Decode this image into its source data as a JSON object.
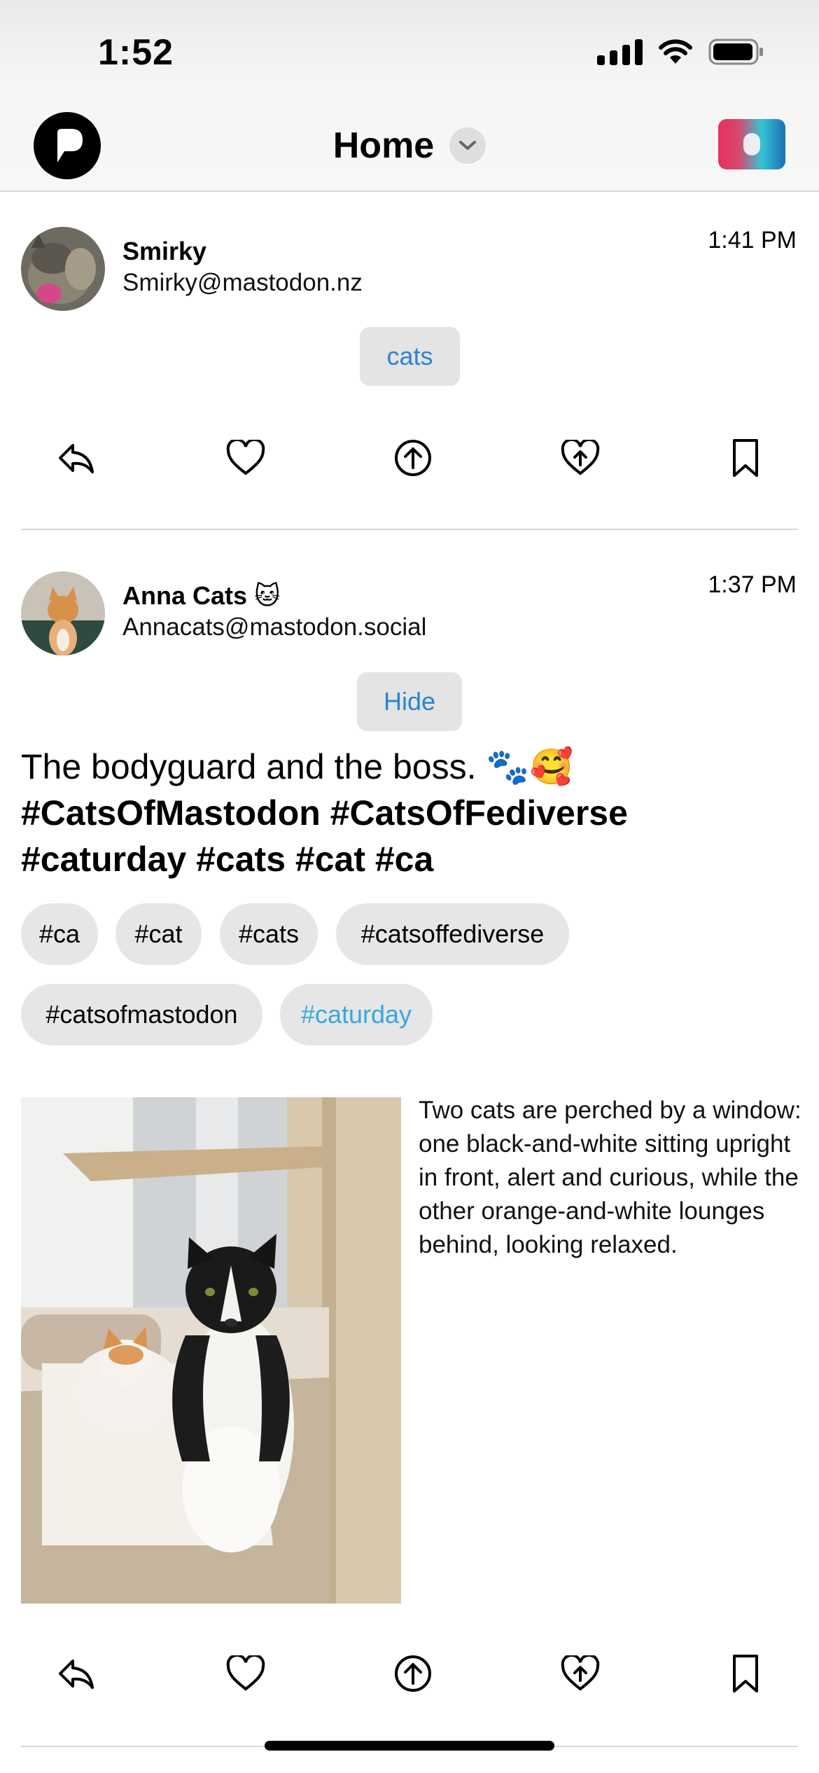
{
  "status_bar": {
    "time": "1:52"
  },
  "header": {
    "title": "Home"
  },
  "posts": [
    {
      "display_name": "Smirky",
      "handle": "Smirky@mastodon.nz",
      "time": "1:41 PM",
      "content_warning_button": "cats"
    },
    {
      "display_name": "Anna Cats 🐱",
      "handle": "Annacats@mastodon.social",
      "time": "1:37 PM",
      "content_warning_button": "Hide",
      "text_plain": "The bodyguard and the boss. 🐾🥰",
      "text_hashtags_line1": "#CatsOfMastodon #CatsOfFediverse",
      "text_hashtags_line2": "#caturday #cats #cat #ca",
      "tags": [
        "#ca",
        "#cat",
        "#cats",
        "#catsoffediverse",
        "#catsofmastodon",
        "#caturday"
      ],
      "media_alt": "Two cats are perched by a window: one black-and-white sitting upright in front, alert and curious, while the other orange-and-white lounges behind, looking relaxed."
    }
  ],
  "colors": {
    "link": "#2b84d3",
    "highlight_tag": "#38a8dc",
    "chip_bg": "#e6e6e6"
  }
}
